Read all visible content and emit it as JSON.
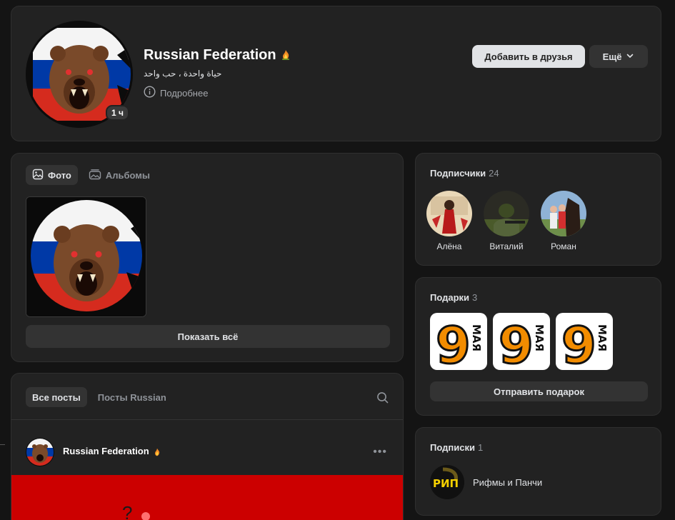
{
  "profile": {
    "name": "Russian Federation",
    "status": "حياة واحدة ، حب واحد",
    "details_label": "Подробнее",
    "online_badge": "1 ч",
    "add_friend_label": "Добавить в друзья",
    "more_label": "Ещё"
  },
  "photos": {
    "tab_photos": "Фото",
    "tab_albums": "Альбомы",
    "show_all_label": "Показать всё"
  },
  "posts": {
    "tab_all": "Все посты",
    "tab_owner": "Посты Russian",
    "author": "Russian Federation"
  },
  "followers": {
    "title": "Подписчики",
    "count": "24",
    "items": [
      {
        "name": "Алёна"
      },
      {
        "name": "Виталий"
      },
      {
        "name": "Роман"
      }
    ]
  },
  "gifts": {
    "title": "Подарки",
    "count": "3",
    "gift_digit": "9",
    "gift_word": "МАЯ",
    "send_label": "Отправить подарок"
  },
  "subscriptions": {
    "title": "Подписки",
    "count": "1",
    "items": [
      {
        "name": "Рифмы и Панчи",
        "logo_text": "РИП"
      }
    ]
  },
  "colors": {
    "background": "#141414",
    "card": "#222222",
    "button_light": "#e1e3e6",
    "button_dark": "#333333",
    "flag_red": "#d52b1e",
    "flag_blue": "#0039a6"
  }
}
